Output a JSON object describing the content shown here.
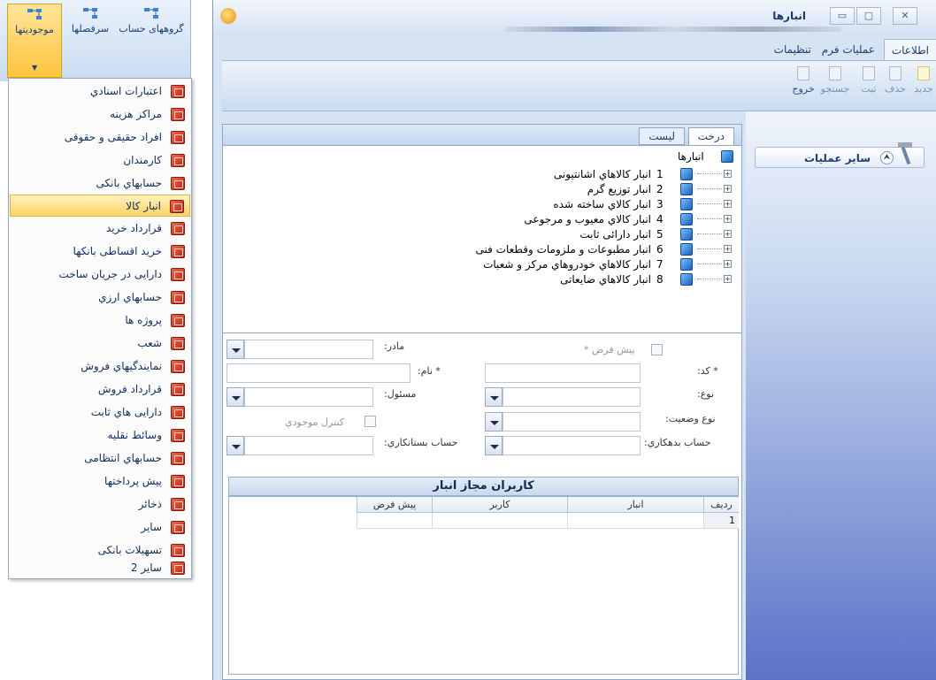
{
  "left_ribbon": {
    "buttons": [
      {
        "label": "موجودیتها",
        "active": true
      },
      {
        "label": "سرفصلها"
      },
      {
        "label": "گروههای حساب"
      }
    ]
  },
  "menu": {
    "items": [
      {
        "label": "اعتبارات اسنادي"
      },
      {
        "label": "مراکز هزینه"
      },
      {
        "label": "افراد حقیقی و حقوقی"
      },
      {
        "label": "کارمندان"
      },
      {
        "label": "حسابهاي بانکی"
      },
      {
        "label": "انبار کالا",
        "selected": true
      },
      {
        "label": "قرارداد خرید"
      },
      {
        "label": "خرید اقساطی بانکها"
      },
      {
        "label": "دارایی در جریان ساخت"
      },
      {
        "label": "حسابهاي ارزي"
      },
      {
        "label": "پروژه ها"
      },
      {
        "label": "شعب"
      },
      {
        "label": "نمایندگیهاي فروش"
      },
      {
        "label": "قرارداد فروش"
      },
      {
        "label": "دارایی هاي ثابت"
      },
      {
        "label": "وسائط نقلیه"
      },
      {
        "label": "حسابهاي انتظامی"
      },
      {
        "label": "پیش پرداختها"
      },
      {
        "label": "ذخائر"
      },
      {
        "label": "سایر"
      },
      {
        "label": "تسهیلات بانکی"
      },
      {
        "label": "سایر 2"
      }
    ]
  },
  "window": {
    "title": "انبارها",
    "controls": {
      "minimize": "▭",
      "restore": "▢",
      "close": "✕"
    }
  },
  "ribbon": {
    "tabs": [
      {
        "label": "اطلاعات",
        "active": true
      },
      {
        "label": "عملیات فرم"
      },
      {
        "label": "تنظیمات"
      }
    ],
    "buttons": {
      "new": "جدید",
      "delete": "حذف",
      "save": "ثبت",
      "search": "جستجو",
      "exit": "خروج"
    }
  },
  "side_panel": {
    "title": "سایر عملیات",
    "collapse_icon": "double-chevron-up-icon"
  },
  "tree_tabs": {
    "tree": "درخت",
    "list": "لیست"
  },
  "tree": {
    "root": "انبارها",
    "nodes": [
      {
        "num": "1",
        "label": "انبار کالاهاي اشانتیونی"
      },
      {
        "num": "2",
        "label": "انبار توزیع گرم"
      },
      {
        "num": "3",
        "label": "انبار کالاي ساخته شده"
      },
      {
        "num": "4",
        "label": "انبار کالاي معیوب و مرجوعی"
      },
      {
        "num": "5",
        "label": "انبار دارائی ثابت"
      },
      {
        "num": "6",
        "label": "انبار مطبوعات و ملزومات وقطعات فنی"
      },
      {
        "num": "7",
        "label": "انبار کالاهاي خودروهاي مرکز و شعبات"
      },
      {
        "num": "8",
        "label": "انبار کالاهاي ضایعاتی"
      }
    ]
  },
  "form": {
    "default_label": "پیش فرض *",
    "parent_label": "مادر:",
    "code_label": "* کد:",
    "name_label": "* نام:",
    "type_label": "نوع:",
    "responsible_label": "مسئول:",
    "status_type_label": "نوع وضعیت:",
    "stock_control_label": "کنترل موجودي",
    "debit_account_label": "حساب بدهکاري:",
    "credit_account_label": "حساب بستانکاري:"
  },
  "grid": {
    "title": "کاربران مجاز انبار",
    "columns": [
      "ردیف",
      "انبار",
      "کاربر",
      "پیش فرض"
    ],
    "rows": [
      {
        "row": "1",
        "warehouse": "",
        "user": "",
        "default": ""
      }
    ]
  }
}
